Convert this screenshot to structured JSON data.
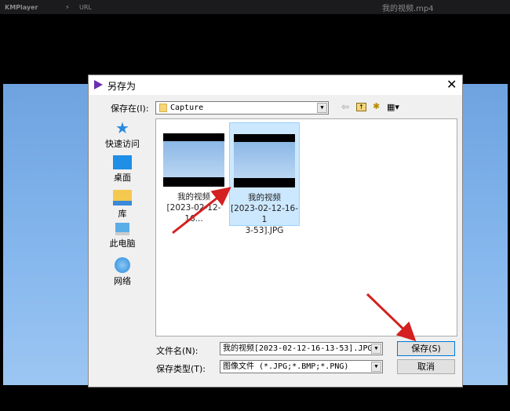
{
  "player": {
    "app_name": "KMPlayer",
    "url_label": "URL",
    "file_title": "我的视频.mp4"
  },
  "dialog": {
    "title": "另存为",
    "save_in_label": "保存在(I):",
    "save_in_value": "Capture",
    "sidebar": [
      {
        "label": "快速访问",
        "icon": "star-icon"
      },
      {
        "label": "桌面",
        "icon": "desktop-icon"
      },
      {
        "label": "库",
        "icon": "library-folder-icon"
      },
      {
        "label": "此电脑",
        "icon": "computer-icon"
      },
      {
        "label": "网络",
        "icon": "network-icon"
      }
    ],
    "files": [
      {
        "line1": "我的视频",
        "line2": "[2023-02-12-16...",
        "selected": false
      },
      {
        "line1": "我的视频",
        "line2": "[2023-02-12-16-1",
        "line3": "3-53].JPG",
        "selected": true
      }
    ],
    "filename_label": "文件名(N):",
    "filename_value": "我的视频[2023-02-12-16-13-53].JPG",
    "filetype_label": "保存类型(T):",
    "filetype_value": "图像文件 (*.JPG;*.BMP;*.PNG)",
    "save_button": "保存(S)",
    "cancel_button": "取消"
  },
  "colors": {
    "accent": "#cce8ff",
    "arrow": "#d42020",
    "logo": "#6b2fb3"
  }
}
